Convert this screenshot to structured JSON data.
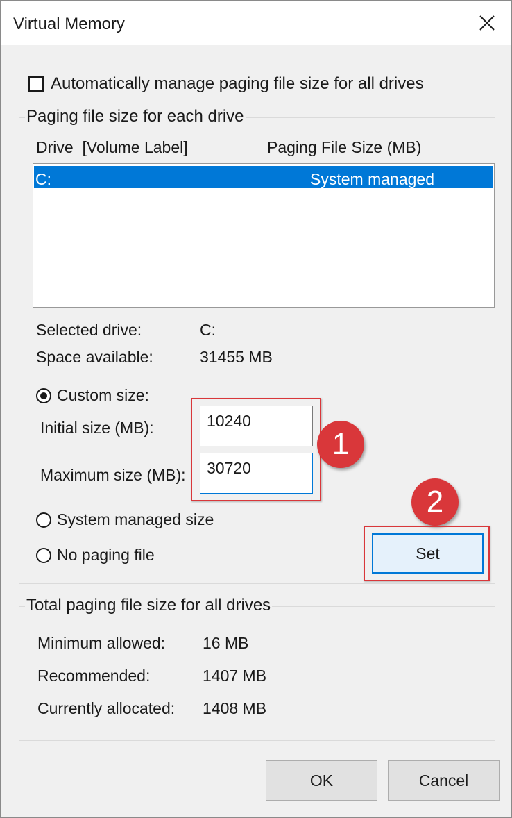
{
  "window": {
    "title": "Virtual Memory",
    "close_icon": "close-icon"
  },
  "auto_manage": {
    "label": "Automatically manage paging file size for all drives",
    "checked": false
  },
  "paging_group": {
    "legend": "Paging file size for each drive",
    "col_drive": "Drive  [Volume Label]",
    "col_size": "Paging File Size (MB)",
    "rows": [
      {
        "drive": "C:",
        "size": "System managed",
        "selected": true
      }
    ]
  },
  "selected": {
    "drive_label": "Selected drive:",
    "drive_value": "C:",
    "space_label": "Space available:",
    "space_value": "31455 MB"
  },
  "options": {
    "custom": "Custom size:",
    "initial_label": "Initial size (MB):",
    "initial_value": "10240",
    "max_label": "Maximum size (MB):",
    "max_value": "30720",
    "system": "System managed size",
    "none": "No paging file",
    "selected_option": "custom"
  },
  "annotations": {
    "badge1": "1",
    "badge2": "2",
    "color": "#d9373a"
  },
  "buttons": {
    "set": "Set",
    "ok": "OK",
    "cancel": "Cancel"
  },
  "total_group": {
    "legend": "Total paging file size for all drives",
    "min_label": "Minimum allowed:",
    "min_value": "16 MB",
    "rec_label": "Recommended:",
    "rec_value": "1407 MB",
    "cur_label": "Currently allocated:",
    "cur_value": "1408 MB"
  },
  "colors": {
    "selection": "#0078d7",
    "background": "#f0f0f0"
  }
}
